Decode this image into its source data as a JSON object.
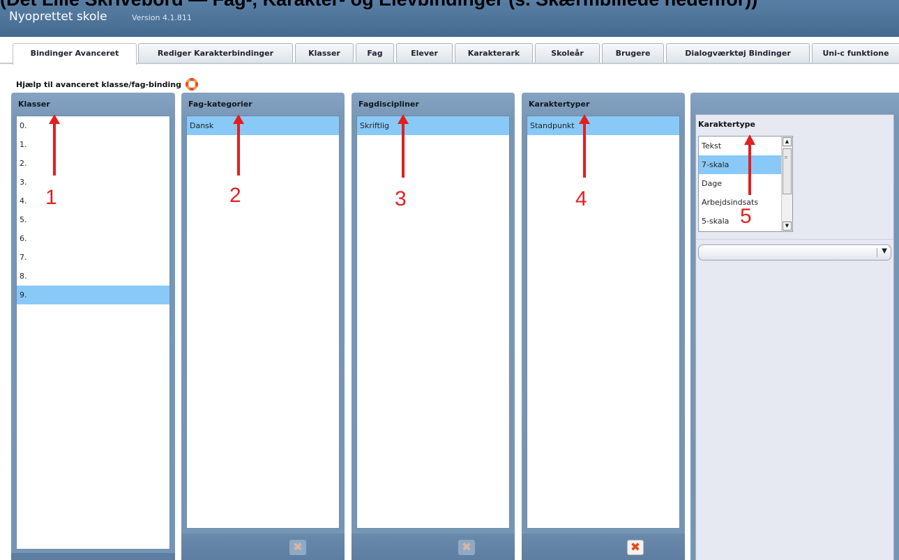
{
  "header_cutoff": "(Det Lille Skrivebord — Fag-, Karakter- og Elevbindinger (s. Skærmbillede nedenfor))",
  "app": {
    "title": "Nyoprettet skole",
    "version": "Version 4.1.811"
  },
  "tabs": [
    {
      "label": "Bindinger Avanceret",
      "active": true
    },
    {
      "label": "Rediger Karakterbindinger"
    },
    {
      "label": "Klasser"
    },
    {
      "label": "Fag"
    },
    {
      "label": "Elever"
    },
    {
      "label": "Karakterark"
    },
    {
      "label": "Skoleår"
    },
    {
      "label": "Brugere"
    },
    {
      "label": "Dialogværktøj Bindinger"
    },
    {
      "label": "Uni-c funktione"
    }
  ],
  "help": {
    "text": "Hjælp til avanceret klasse/fag-binding",
    "icon": "lifebuoy-icon"
  },
  "panels": [
    {
      "title": "Klasser",
      "items": [
        "0.",
        "1.",
        "2.",
        "3.",
        "4.",
        "5.",
        "6.",
        "7.",
        "8.",
        "9."
      ],
      "selected": 9
    },
    {
      "title": "Fag-kategorier",
      "items": [
        "Dansk"
      ],
      "selected": 0
    },
    {
      "title": "Fagdiscipliner",
      "items": [
        "Skriftlig"
      ],
      "selected": 0
    },
    {
      "title": "Karaktertyper",
      "items": [
        "Standpunkt"
      ],
      "selected": 0
    }
  ],
  "karaktertype": {
    "title": "Karaktertype",
    "items": [
      "Tekst",
      "7-skala",
      "Dage",
      "Arbejdsindsats",
      "5-skala"
    ],
    "selected": 1,
    "dropdown_value": ""
  },
  "annotations": [
    "1",
    "2",
    "3",
    "4",
    "5"
  ],
  "colors": {
    "header_bg": "#4e7499",
    "panel_bg": "#7796b6",
    "selection": "#89c9f7",
    "annotation": "#e11f1f",
    "delete_icon": "#ea4b16"
  }
}
